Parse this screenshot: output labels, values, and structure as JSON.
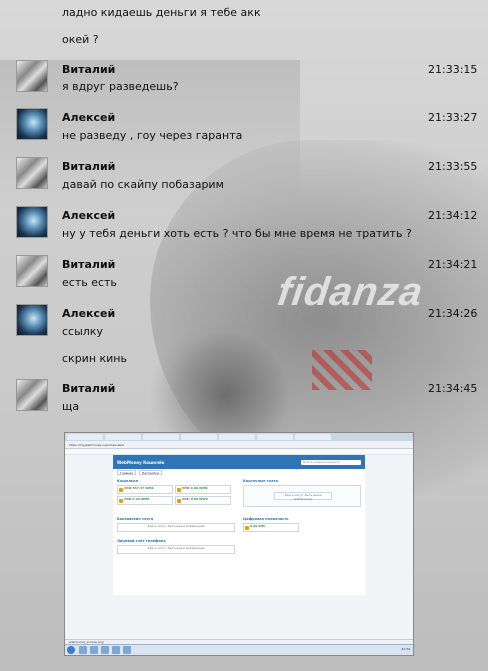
{
  "background": {
    "brand_text": "fidanza"
  },
  "chat": {
    "top_lines": [
      "ладно кидаешь деньги я тебе акк",
      "окей ?"
    ],
    "messages": [
      {
        "author": "Виталий",
        "time": "21:33:15",
        "lines": [
          "я вдруг разведешь?"
        ]
      },
      {
        "author": "Алексей",
        "time": "21:33:27",
        "lines": [
          "не разведу , гоу через гаранта"
        ]
      },
      {
        "author": "Виталий",
        "time": "21:33:55",
        "lines": [
          "давай по скайпу побазарим"
        ]
      },
      {
        "author": "Алексей",
        "time": "21:34:12",
        "lines": [
          "ну у тебя деньги хоть есть ? что бы мне время не тратить ?"
        ]
      },
      {
        "author": "Виталий",
        "time": "21:34:21",
        "lines": [
          "есть есть"
        ]
      },
      {
        "author": "Алексей",
        "time": "21:34:26",
        "lines": [
          "ссылку",
          "скрин кинь"
        ]
      },
      {
        "author": "Виталий",
        "time": "21:34:45",
        "lines": [
          "ща"
        ]
      }
    ]
  },
  "screenshot": {
    "address": "https://my.webmoney.ru/purses.aspx",
    "logo": "WebMoney Кошелёк",
    "search_placeholder": "Поиск корреспондента",
    "nav": [
      "Главная",
      "Настройки"
    ],
    "sections": {
      "wallets": "Кошельки",
      "cards": "Карточные счета",
      "bank": "Банковские счета",
      "digital": "Цифровая наличность",
      "phone": "Лицевой счёт телефона"
    },
    "wallets": [
      {
        "label": "WMZ",
        "amount": "537.37 WMZ"
      },
      {
        "label": "WMR",
        "amount": "0.00 WMR"
      },
      {
        "label": "WME",
        "amount": "0.00 WME"
      },
      {
        "label": "WMU",
        "amount": "0.00 WMU"
      }
    ],
    "digital_amount": "0.00 WM",
    "add_label": "Здесь могут быть ваши добавления",
    "status_text": "webmoney_purses.png",
    "clock": "21:34"
  }
}
